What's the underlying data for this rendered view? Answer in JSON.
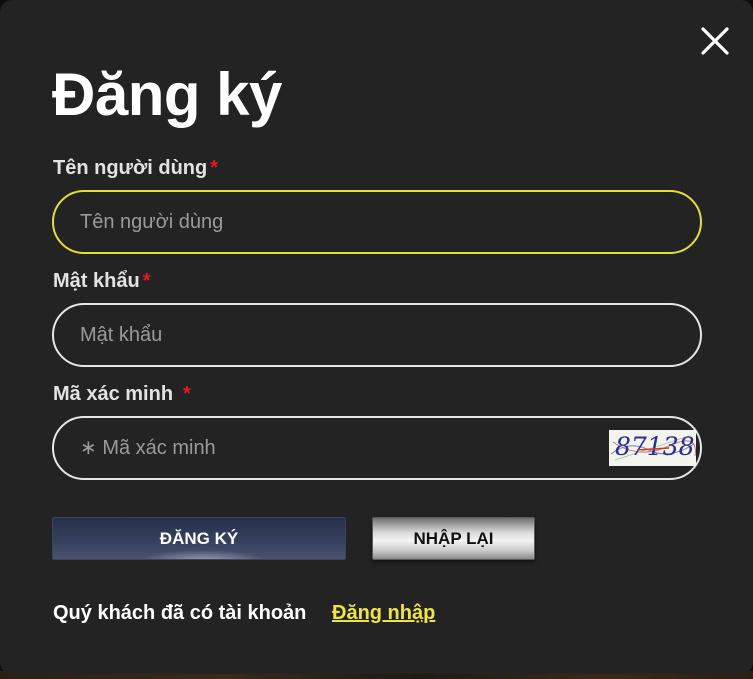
{
  "modal": {
    "title": "Đăng ký",
    "close_icon": "close-icon"
  },
  "form": {
    "username": {
      "label": "Tên người dùng",
      "required_mark": "*",
      "placeholder": "Tên người dùng",
      "value": ""
    },
    "password": {
      "label": "Mật khẩu",
      "required_mark": "*",
      "placeholder": "Mật khẩu",
      "value": ""
    },
    "captcha": {
      "label": "Mã xác minh",
      "required_mark": "*",
      "placeholder": "∗ Mã xác minh",
      "value": "",
      "image_text": "87138"
    }
  },
  "buttons": {
    "register_label": "ĐĂNG KÝ",
    "reset_label": "NHẬP LẠI"
  },
  "footer": {
    "prompt": "Quý khách đã có tài khoản",
    "login_link": "Đăng nhập"
  },
  "colors": {
    "modal_bg": "#232323",
    "focus_border": "#e4dd3e",
    "link": "#efe34a",
    "required": "#e11d1d"
  }
}
